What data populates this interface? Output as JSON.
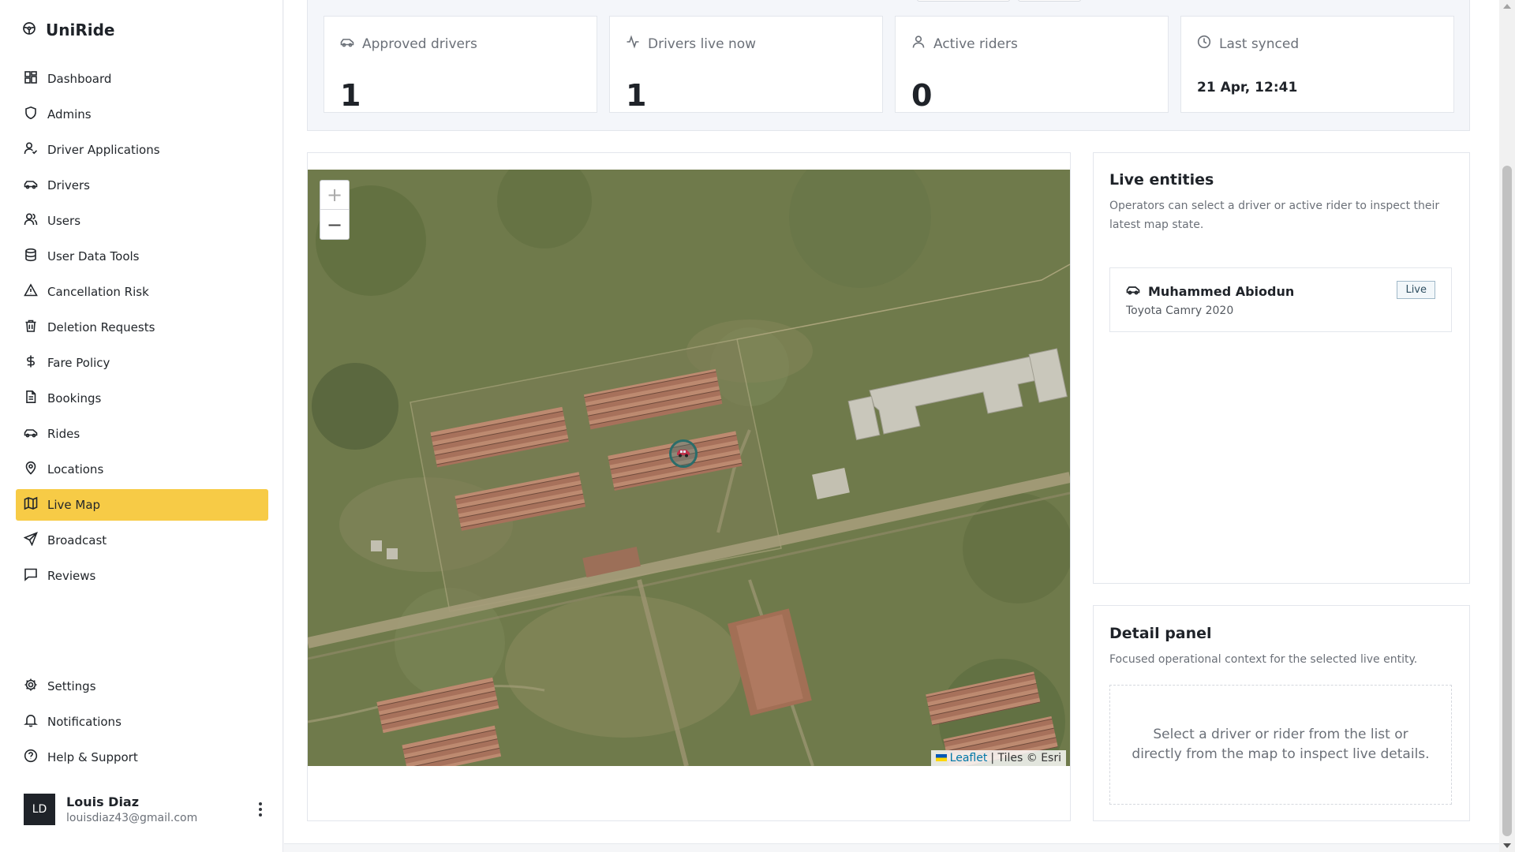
{
  "brand": {
    "name": "UniRide",
    "icon": "steering-wheel-icon"
  },
  "sidebar": {
    "items": [
      {
        "label": "Dashboard",
        "icon": "dashboard-icon",
        "active": false
      },
      {
        "label": "Admins",
        "icon": "shield-icon",
        "active": false
      },
      {
        "label": "Driver Applications",
        "icon": "user-check-icon",
        "active": false
      },
      {
        "label": "Drivers",
        "icon": "car-icon",
        "active": false
      },
      {
        "label": "Users",
        "icon": "users-icon",
        "active": false
      },
      {
        "label": "User Data Tools",
        "icon": "database-icon",
        "active": false
      },
      {
        "label": "Cancellation Risk",
        "icon": "warning-icon",
        "active": false
      },
      {
        "label": "Deletion Requests",
        "icon": "trash-icon",
        "active": false
      },
      {
        "label": "Fare Policy",
        "icon": "dollar-icon",
        "active": false
      },
      {
        "label": "Bookings",
        "icon": "document-icon",
        "active": false
      },
      {
        "label": "Rides",
        "icon": "car-icon",
        "active": false
      },
      {
        "label": "Locations",
        "icon": "map-pin-icon",
        "active": false
      },
      {
        "label": "Live Map",
        "icon": "map-icon",
        "active": true
      },
      {
        "label": "Broadcast",
        "icon": "send-icon",
        "active": false
      },
      {
        "label": "Reviews",
        "icon": "message-square-icon",
        "active": false
      }
    ],
    "bottom_items": [
      {
        "label": "Settings",
        "icon": "gear-icon"
      },
      {
        "label": "Notifications",
        "icon": "bell-icon"
      },
      {
        "label": "Help & Support",
        "icon": "help-circle-icon"
      }
    ]
  },
  "user": {
    "initials": "LD",
    "name": "Louis Diaz",
    "email": "louisdiaz43@gmail.com"
  },
  "stats": [
    {
      "label": "Approved drivers",
      "value": "1",
      "icon": "car-icon"
    },
    {
      "label": "Drivers live now",
      "value": "1",
      "icon": "activity-icon"
    },
    {
      "label": "Active riders",
      "value": "0",
      "icon": "user-icon"
    },
    {
      "label": "Last synced",
      "value": "21 Apr, 12:41",
      "icon": "clock-icon"
    }
  ],
  "map": {
    "zoom_in": "+",
    "zoom_out": "−",
    "attribution_leaflet": "Leaflet",
    "attribution_tiles": "| Tiles © Esri"
  },
  "live_entities": {
    "title": "Live entities",
    "description": "Operators can select a driver or active rider to inspect their latest map state.",
    "items": [
      {
        "name": "Muhammed Abiodun",
        "vehicle": "Toyota Camry 2020",
        "status": "Live"
      }
    ]
  },
  "detail_panel": {
    "title": "Detail panel",
    "description": "Focused operational context for the selected live entity.",
    "empty_text": "Select a driver or rider from the list or directly from the map to inspect live details."
  },
  "colors": {
    "accent": "#f7cb46",
    "text": "#1f2329",
    "muted": "#6b7078"
  }
}
